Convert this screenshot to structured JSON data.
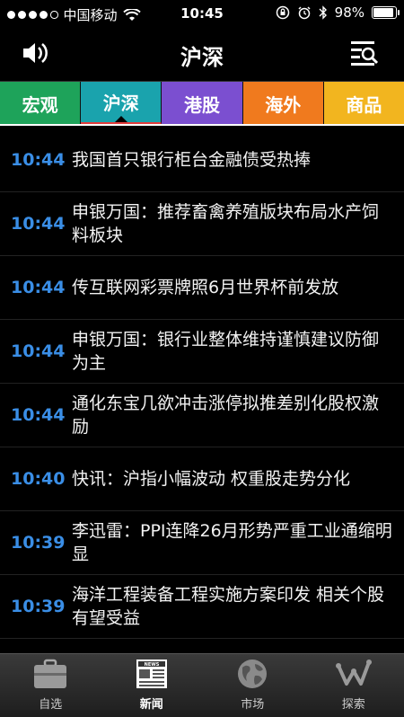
{
  "status": {
    "carrier": "中国移动",
    "time": "10:45",
    "battery": "98%",
    "battery_level": 0.98
  },
  "header": {
    "title": "沪深"
  },
  "tabs": [
    {
      "label": "宏观",
      "color": "#1ea35a"
    },
    {
      "label": "沪深",
      "color": "#1aa3ad"
    },
    {
      "label": "港股",
      "color": "#7b4fd0"
    },
    {
      "label": "海外",
      "color": "#f07a1e"
    },
    {
      "label": "商品",
      "color": "#f2b51f"
    }
  ],
  "news": [
    {
      "time": "10:44",
      "text": "我国首只银行柜台金融债受热捧"
    },
    {
      "time": "10:44",
      "text": "申银万国：推荐畜禽养殖版块布局水产饲料板块"
    },
    {
      "time": "10:44",
      "text": "传互联网彩票牌照6月世界杯前发放"
    },
    {
      "time": "10:44",
      "text": "申银万国：银行业整体维持谨慎建议防御为主"
    },
    {
      "time": "10:44",
      "text": "通化东宝几欲冲击涨停拟推差别化股权激励"
    },
    {
      "time": "10:40",
      "text": "快讯：沪指小幅波动 权重股走势分化"
    },
    {
      "time": "10:39",
      "text": "李迅雷：PPI连降26月形势严重工业通缩明显"
    },
    {
      "time": "10:39",
      "text": "海洋工程装备工程实施方案印发 相关个股有望受益"
    }
  ],
  "tabbar": [
    {
      "label": "自选",
      "icon": "briefcase-icon"
    },
    {
      "label": "新闻",
      "icon": "newspaper-icon"
    },
    {
      "label": "市场",
      "icon": "globe-icon"
    },
    {
      "label": "探索",
      "icon": "discover-icon"
    }
  ]
}
